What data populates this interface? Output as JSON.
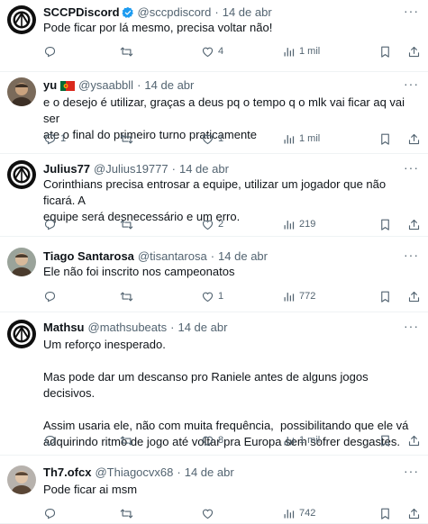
{
  "tweets": [
    {
      "name": "SCCPDiscord",
      "verified": true,
      "handle": "@sccpdiscord",
      "date": "14 de abr",
      "text": [
        "Pode ficar por lá mesmo, precisa voltar não!"
      ],
      "replies": "",
      "retweets": "",
      "likes": "4",
      "views": "1 mil",
      "avatar": "corinthians-logo-icon"
    },
    {
      "name": "yu",
      "flag": "portugal-flag-icon",
      "handle": "@ysaabbll",
      "date": "14 de abr",
      "text": [
        "e o desejo é utilizar, graças a deus pq o tempo q o mlk vai ficar aq vai ser\nate o final do primeiro turno praticamente"
      ],
      "replies": "1",
      "retweets": "",
      "likes": "1",
      "views": "1 mil",
      "avatar": "user-photo-avatar"
    },
    {
      "name": "Julius77",
      "handle": "@Julius19777",
      "date": "14 de abr",
      "text": [
        "Corinthians precisa entrosar a equipe, utilizar um jogador que não ficará. A\nequipe será desnecessário e um erro."
      ],
      "replies": "",
      "retweets": "",
      "likes": "2",
      "views": "219",
      "avatar": "corinthians-logo-icon"
    },
    {
      "name": "Tiago Santarosa",
      "handle": "@tisantarosa",
      "date": "14 de abr",
      "text": [
        "Ele não foi inscrito nos campeonatos"
      ],
      "replies": "",
      "retweets": "",
      "likes": "1",
      "views": "772",
      "avatar": "user-photo-avatar"
    },
    {
      "name": "Mathsu",
      "handle": "@mathsubeats",
      "date": "14 de abr",
      "text": [
        "Um reforço inesperado.",
        "Mas pode dar um descanso pro Raniele antes de alguns jogos decisivos.",
        "Assim usaria ele, não com muita frequência,  possibilitando que ele vá\nadquirindo ritmo de jogo até voltar pra Europa sem sofrer desgastes."
      ],
      "replies": "",
      "retweets": "",
      "likes": "8",
      "views": "1 mil",
      "avatar": "corinthians-logo-icon"
    },
    {
      "name": "Th7.ofcx",
      "handle": "@Thiagocvx68",
      "date": "14 de abr",
      "text": [
        "Pode ficar ai msm"
      ],
      "replies": "",
      "retweets": "",
      "likes": "",
      "views": "742",
      "avatar": "user-photo-avatar"
    }
  ],
  "colors": {
    "text": "#0f1419",
    "secondary": "#536471",
    "verified": "#1d9bf0",
    "divider": "#eff3f4"
  }
}
